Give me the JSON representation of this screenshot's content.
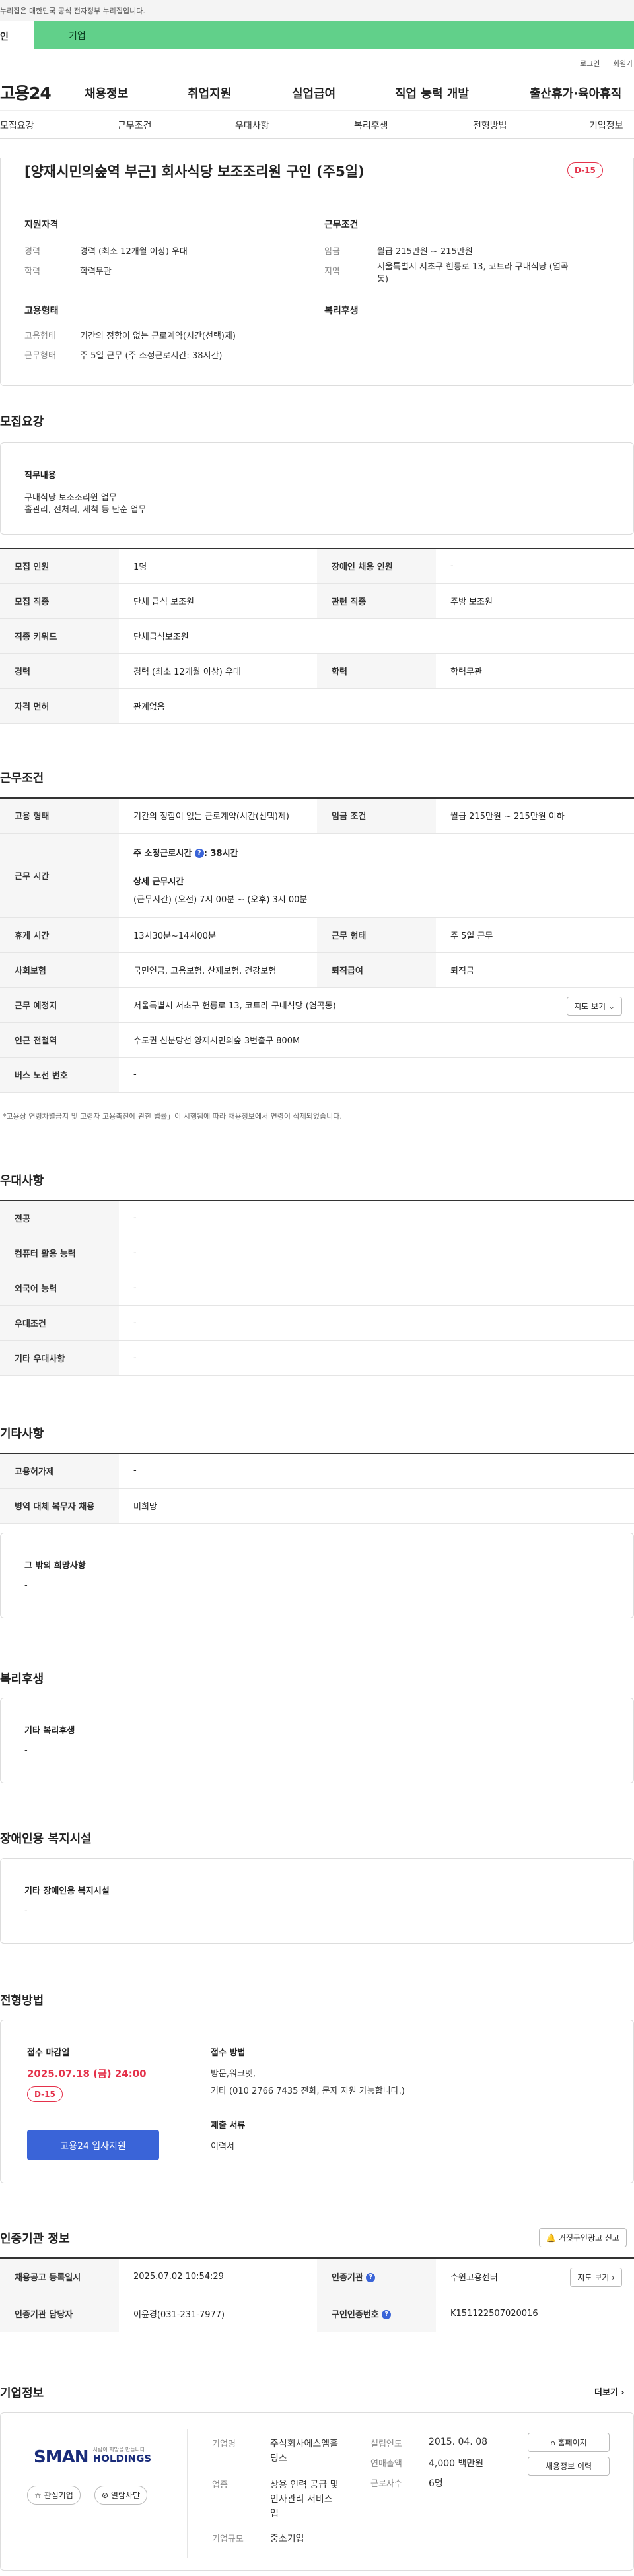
{
  "gov_notice": "누리집은 대한민국 공식 전자정부 누리집입니다.",
  "top_tabs": {
    "personal": "인",
    "company": "기업"
  },
  "util": {
    "login": "로그인",
    "signup": "회원가"
  },
  "logo": "고용24",
  "gnb": [
    "채용정보",
    "취업지원",
    "실업급여",
    "직업 능력 개발",
    "출산휴가·육아휴직"
  ],
  "anchors": [
    "모집요강",
    "근무조건",
    "우대사항",
    "복리후생",
    "전형방법",
    "기업정보"
  ],
  "summary": {
    "title": "[양재시민의숲역 부근] 회사식당 보조조리원 구인 (주5일)",
    "dday": "D-15",
    "qual_label": "지원자격",
    "career_k": "경력",
    "career_v": "경력 (최소 12개월 이상) 우대",
    "edu_k": "학력",
    "edu_v": "학력무관",
    "cond_label": "근무조건",
    "wage_k": "임금",
    "wage_v": "월급 215만원 ~ 215만원",
    "region_k": "지역",
    "region_v1": "서울특별시 서초구 헌릉로 13, 코트라 구내식당 (염곡",
    "region_v2": "동)",
    "emp_label": "고용형태",
    "etype_k": "고용형태",
    "etype_v": "기간의 정함이 없는 근로계약(시간(선택)제)",
    "wtype_k": "근무형태",
    "wtype_v": "주 5일 근무 (주 소정근로시간: 38시간)",
    "welfare_label": "복리후생"
  },
  "recruit": {
    "title": "모집요강",
    "duty_label": "직무내용",
    "duty_1": "구내식당 보조조리원 업무",
    "duty_2": "홀관리, 전처리, 세척 등 단순 업무",
    "rows": [
      {
        "k1": "모집 인원",
        "v1": "1명",
        "k2": "장애인 채용 인원",
        "v2": "-"
      },
      {
        "k1": "모집 직종",
        "v1": "단체 급식 보조원",
        "k2": "관련 직종",
        "v2": "주방 보조원"
      },
      {
        "k1": "직종 키워드",
        "v1": "단체급식보조원",
        "k2": "",
        "v2": ""
      },
      {
        "k1": "경력",
        "v1": "경력 (최소 12개월 이상) 우대",
        "k2": "학력",
        "v2": "학력무관"
      },
      {
        "k1": "자격 면허",
        "v1": "관계없음",
        "k2": "",
        "v2": ""
      }
    ]
  },
  "work": {
    "title": "근무조건",
    "emp_k": "고용 형태",
    "emp_v": "기간의 정함이 없는 근로계약(시간(선택)제)",
    "wage_k": "임금 조건",
    "wage_v": "월급 215만원 ~ 215만원 이하",
    "time_k": "근무 시간",
    "time_a": "주 소정근로시간",
    "time_a2": ": 38시간",
    "time_b": "상세 근무시간",
    "time_c": "(근무시간) (오전) 7시 00분 ~ (오후) 3시 00분",
    "rest_k": "휴게 시간",
    "rest_v": "13시30분~14시00분",
    "form_k": "근무 형태",
    "form_v": "주 5일 근무",
    "ins_k": "사회보험",
    "ins_v": "국민연금, 고용보험, 산재보험, 건강보험",
    "ret_k": "퇴직급여",
    "ret_v": "퇴직금",
    "loc_k": "근무 예정지",
    "loc_v": "서울특별시 서초구 헌릉로 13, 코트라 구내식당 (염곡동)",
    "map_btn": "지도 보기",
    "sub_k": "인근 전철역",
    "sub_v": "수도권 신분당선 양재시민의숲 3번출구 800M",
    "bus_k": "버스 노선 번호",
    "bus_v": "-",
    "note": "*고용상 연령차별금지 및 고령자 고용촉진에 관한 법률」이 시행됨에 따라 채용정보에서 연령이 삭제되었습니다."
  },
  "pref": {
    "title": "우대사항",
    "rows": [
      {
        "k": "전공",
        "v": "-"
      },
      {
        "k": "컴퓨터 활용 능력",
        "v": "-"
      },
      {
        "k": "외국어 능력",
        "v": "-"
      },
      {
        "k": "우대조건",
        "v": "-"
      },
      {
        "k": "기타 우대사항",
        "v": "-"
      }
    ]
  },
  "etc": {
    "title": "기타사항",
    "rows": [
      {
        "k": "고용허가제",
        "v": "-"
      },
      {
        "k": "병역 대체 복무자 채용",
        "v": "비희망"
      }
    ],
    "wish_label": "그 밖의 희망사항",
    "wish_v": "-"
  },
  "welfare": {
    "title": "복리후생",
    "label": "기타 복리후생",
    "v": "-"
  },
  "disab": {
    "title": "장애인용 복지시설",
    "label": "기타 장애인용 복지시설",
    "v": "-"
  },
  "process": {
    "title": "전형방법",
    "deadline_label": "접수 마감일",
    "deadline": "2025.07.18 (금) 24:00",
    "dday": "D-15",
    "apply_btn": "고용24 입사지원",
    "method_label": "접수 방법",
    "method_1": "방문,워크넷,",
    "method_2": "기타 (010 2766 7435 전화, 문자 지원 가능합니다.)",
    "docs_label": "제출 서류",
    "docs_v": "이력서"
  },
  "cert": {
    "title": "인증기관 정보",
    "report_btn": "거짓구인광고 신고",
    "r1k1": "채용공고 등록일시",
    "r1v1": "2025.07.02 10:54:29",
    "r1k2": "인증기관",
    "r1v2": "수원고용센터",
    "map_btn": "지도 보기",
    "r2k1": "인증기관 담당자",
    "r2v1": "이윤경(031-231-7977)",
    "r2k2": "구인인증번호",
    "r2v2": "K151122507020016"
  },
  "company": {
    "title": "기업정보",
    "more": "더보기",
    "logo_big": "SMAN",
    "logo_small": "HOLDINGS",
    "logo_tag": "사람이 희망을 만듭니다",
    "fav_btn": "관심기업",
    "block_btn": "열람차단",
    "name_k": "기업명",
    "name_v1": "주식회사에스엠홀",
    "name_v2": "딩스",
    "biz_k": "업종",
    "biz_v1": "상용 인력 공급 및",
    "biz_v2": "인사관리 서비스",
    "biz_v3": "업",
    "size_k": "기업규모",
    "size_v": "중소기업",
    "est_k": "설립연도",
    "est_v": "2015. 04. 08",
    "rev_k": "연매출액",
    "rev_v": "4,000 백만원",
    "emp_k": "근로자수",
    "emp_v": "6명",
    "home_btn": "홈페이지",
    "hist_btn": "채용정보 이력"
  }
}
